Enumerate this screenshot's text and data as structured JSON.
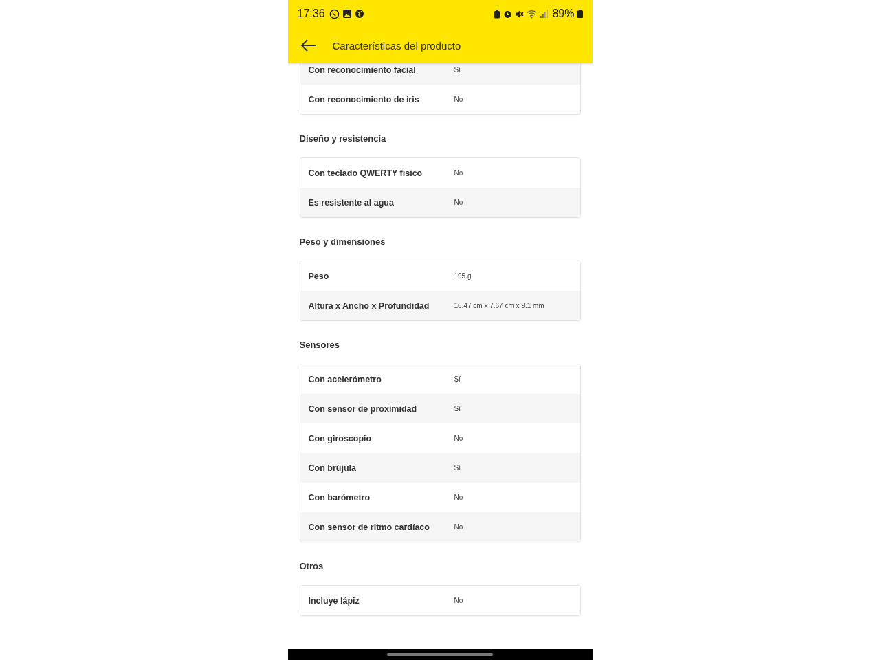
{
  "status_bar": {
    "time": "17:36",
    "battery": "89%"
  },
  "header": {
    "title": "Características del producto"
  },
  "sections": [
    {
      "rows": [
        {
          "label": "Con reconocimiento facial",
          "value": "Sí"
        },
        {
          "label": "Con reconocimiento de iris",
          "value": "No"
        }
      ]
    },
    {
      "title": "Diseño y resistencia",
      "rows": [
        {
          "label": "Con teclado QWERTY físico",
          "value": "No"
        },
        {
          "label": "Es resistente al agua",
          "value": "No"
        }
      ]
    },
    {
      "title": "Peso y dimensiones",
      "rows": [
        {
          "label": "Peso",
          "value": "195 g"
        },
        {
          "label": "Altura x Ancho x Profundidad",
          "value": "16.47 cm x 7.67 cm x 9.1 mm"
        }
      ]
    },
    {
      "title": "Sensores",
      "rows": [
        {
          "label": "Con acelerómetro",
          "value": "Sí"
        },
        {
          "label": "Con sensor de proximidad",
          "value": "Sí"
        },
        {
          "label": "Con giroscopio",
          "value": "No"
        },
        {
          "label": "Con brújula",
          "value": "Sí"
        },
        {
          "label": "Con barómetro",
          "value": "No"
        },
        {
          "label": "Con sensor de ritmo cardíaco",
          "value": "No"
        }
      ]
    },
    {
      "title": "Otros",
      "rows": [
        {
          "label": "Incluye lápiz",
          "value": "No"
        }
      ]
    }
  ]
}
